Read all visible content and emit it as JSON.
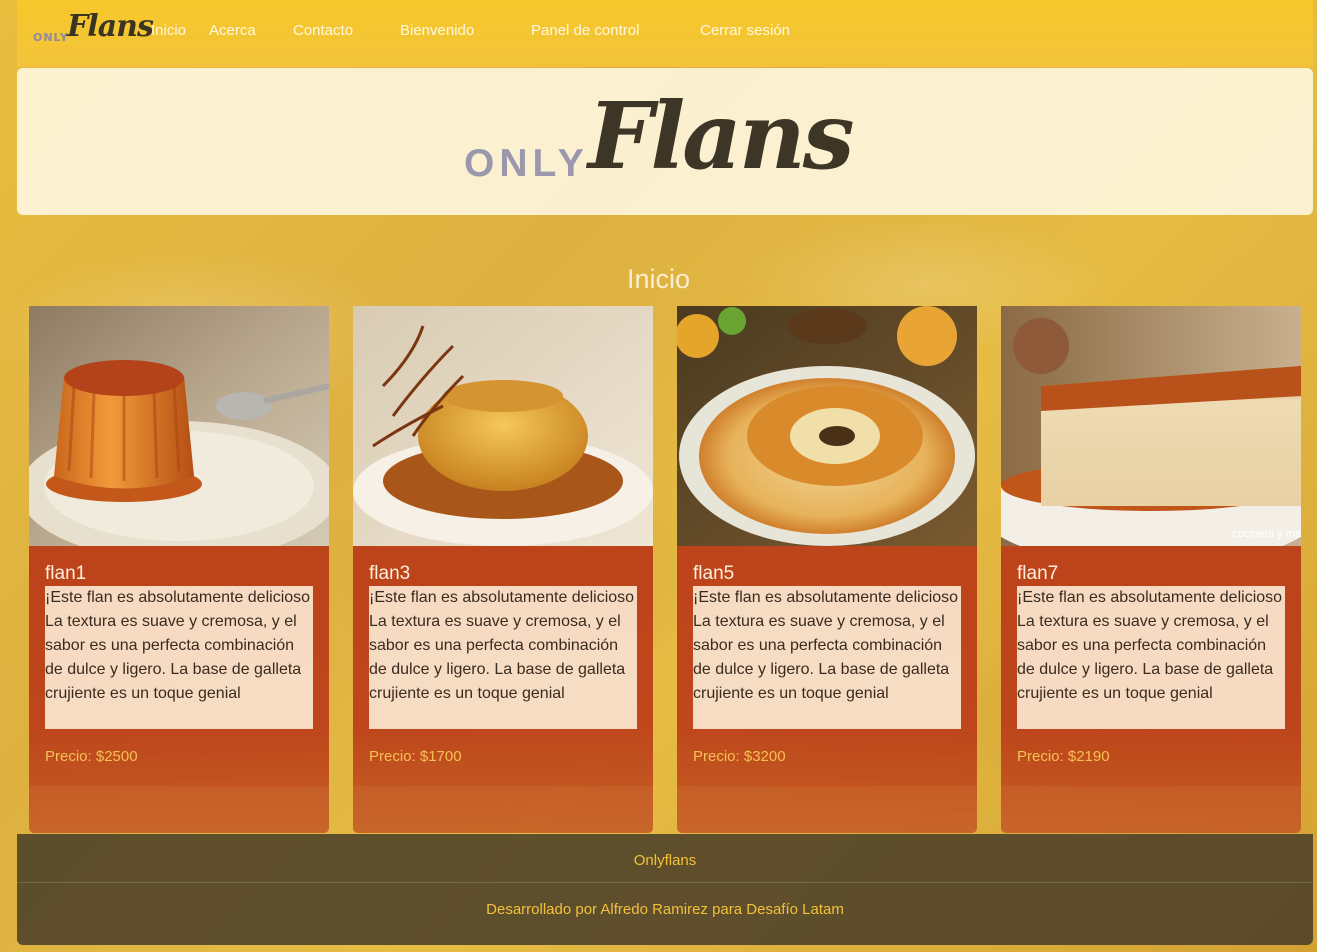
{
  "navbar": {
    "brand_only": "ONLY",
    "brand_flans": "Flans",
    "items": [
      "Inicio",
      "Acerca",
      "Contacto",
      "Bienvenido",
      "Panel de control",
      "Cerrar sesión"
    ]
  },
  "banner": {
    "logo_only": "ONLY",
    "logo_flans": "Flans"
  },
  "section_title": "Inicio",
  "cards": [
    {
      "name": "flan1",
      "description": "¡Este flan es absolutamente delicioso La textura es suave y cremosa, y el sabor es una perfecta combinación de dulce y ligero. La base de galleta crujiente es un toque genial",
      "price": "Precio: $2500"
    },
    {
      "name": "flan3",
      "description": "¡Este flan es absolutamente delicioso La textura es suave y cremosa, y el sabor es una perfecta combinación de dulce y ligero. La base de galleta crujiente es un toque genial",
      "price": "Precio: $1700"
    },
    {
      "name": "flan5",
      "description": "¡Este flan es absolutamente delicioso La textura es suave y cremosa, y el sabor es una perfecta combinación de dulce y ligero. La base de galleta crujiente es un toque genial",
      "price": "Precio: $3200"
    },
    {
      "name": "flan7",
      "description": "¡Este flan es absolutamente delicioso La textura es suave y cremosa, y el sabor es una perfecta combinación de dulce y ligero. La base de galleta crujiente es un toque genial",
      "price": "Precio: $2190",
      "image_watermark": "cocinera y ma"
    }
  ],
  "footer": {
    "name": "Onlyflans",
    "credit": "Desarrollado por Alfredo Ramirez para Desafío Latam"
  },
  "colors": {
    "navbar": "#f7c82a",
    "card": "#b93716",
    "footer_text": "#f2c03a",
    "price": "#f6c153"
  }
}
